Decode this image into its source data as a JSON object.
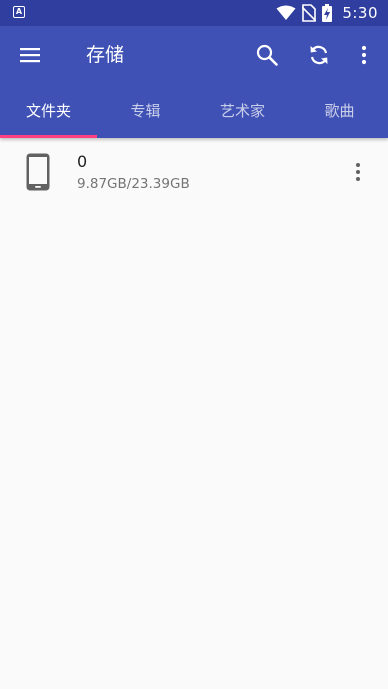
{
  "status_bar": {
    "notification_icon": "A",
    "time": "5:30",
    "icons": [
      "wifi-icon",
      "no-sim-icon",
      "battery-charging-icon"
    ]
  },
  "toolbar": {
    "title": "存储",
    "actions": [
      "search-icon",
      "refresh-icon",
      "more-vertical-icon"
    ]
  },
  "tabs": [
    {
      "label": "文件夹",
      "active": true
    },
    {
      "label": "专辑",
      "active": false
    },
    {
      "label": "艺术家",
      "active": false
    },
    {
      "label": "歌曲",
      "active": false
    }
  ],
  "colors": {
    "primary": "#3f51b5",
    "primary_dark": "#303f9f",
    "accent": "#ff4081",
    "background": "#fafafa",
    "icon_gray": "#616161"
  },
  "storage_list": [
    {
      "name": "0",
      "usage": "9.87GB/23.39GB",
      "icon": "phone-icon"
    }
  ]
}
